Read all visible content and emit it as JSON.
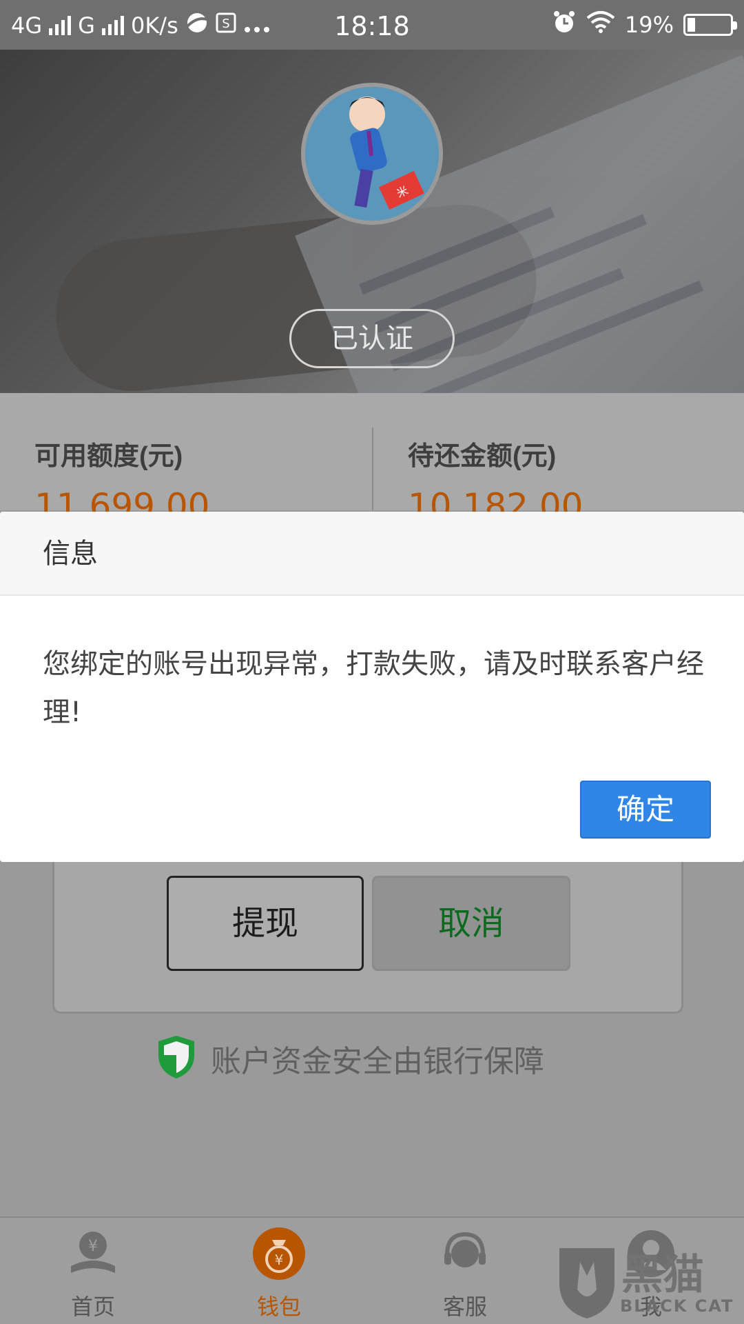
{
  "status_bar": {
    "network": "4G",
    "network2": "G",
    "speed": "0K/s",
    "time": "18:18",
    "battery": "19%",
    "battery_level": 0.19
  },
  "profile": {
    "verified_label": "已认证"
  },
  "limits": {
    "available_label": "可用额度(元)",
    "available_value": "11,699.00",
    "repay_label": "待还金额(元)",
    "repay_value": "10,182.00"
  },
  "actions": {
    "withdraw_label": "提现",
    "cancel_label": "取消"
  },
  "safety": {
    "text": "账户资金安全由银行保障"
  },
  "nav": {
    "items": [
      {
        "label": "首页",
        "icon": "home-yuan-icon"
      },
      {
        "label": "钱包",
        "icon": "wallet-bag-icon"
      },
      {
        "label": "客服",
        "icon": "support-headset-icon"
      },
      {
        "label": "我",
        "icon": "user-icon"
      }
    ],
    "active_index": 1
  },
  "watermark": {
    "text": "黑猫",
    "sub": "BLACK CAT"
  },
  "dialog": {
    "title": "信息",
    "message": "您绑定的账号出现异常，打款失败，请及时联系客户经理!",
    "ok_label": "确定"
  },
  "colors": {
    "accent": "#2f86e6",
    "orange": "#b75500",
    "green": "#0b6a1d"
  }
}
